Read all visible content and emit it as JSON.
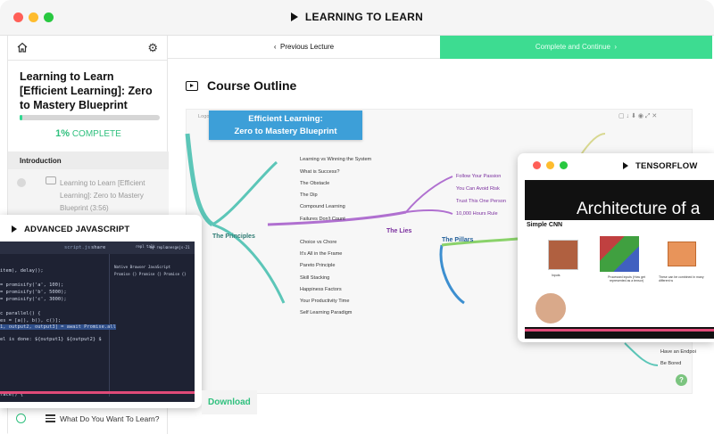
{
  "window": {
    "title": "LEARNING TO LEARN"
  },
  "sidebar": {
    "course_title": "Learning to Learn [Efficient Learning]: Zero to Mastery Blueprint",
    "progress": {
      "percent": 1,
      "percent_text": "1%",
      "label": "COMPLETE"
    },
    "section": "Introduction",
    "lectures": [
      {
        "title": "Learning to Learn [Efficient Learning]: Zero to Mastery Blueprint",
        "duration": "(3:56)"
      }
    ],
    "bottom_item": "What Do You Want To Learn?"
  },
  "nav": {
    "prev": "Previous Lecture",
    "next": "Complete and Continue"
  },
  "main": {
    "heading": "Course Outline",
    "download": "Download",
    "help": "?"
  },
  "mindmap": {
    "root_line1": "Efficient Learning:",
    "root_line2": "Zero to Mastery Blueprint",
    "logo_text": "Logo",
    "branches": {
      "principles": "The Principles",
      "lies": "The Lies",
      "pillars": "The Pillars"
    },
    "principles_items": [
      "Learning vs Winning the System",
      "What is Success?",
      "The Obstacle",
      "The Dip",
      "Compound Learning",
      "Failures Don't Count",
      "Choice vs Chore",
      "It's All in the Frame",
      "Pareto Principle",
      "Skill Stacking",
      "Happiness Factors",
      "Your Productivity Time",
      "Self Learning Paradigm"
    ],
    "lies_items": [
      "Follow Your Passion",
      "You Can Avoid Risk",
      "Trust This One Person",
      "10,000 Hours Rule"
    ],
    "pillars_items": [
      "Have an Endpoi",
      "Be Bored"
    ]
  },
  "js_window": {
    "title": "ADVANCED JAVASCRIPT",
    "tabs": [
      "script.js",
      "share",
      "repl talk",
      "my repls",
      "anesgejs-21"
    ],
    "console_lines": [
      "Native Browser JavaScript",
      "Promise {} Promise {} Promise {}"
    ],
    "code_lines": [
      "item), delay));",
      "= promisify('a', 100);",
      "= promisify('b', 5000);",
      "= promisify('c', 3000);",
      "c parallel() {",
      "es = [a(), b(), c()];",
      "1, output2, output3] = await Promise.all",
      "el is done: ${output1} ${output2} $",
      "race() {"
    ]
  },
  "tf_window": {
    "title": "TENSORFLOW",
    "slide_title": "Architecture of a",
    "slide_subtitle": "Simple CNN",
    "captions": [
      "Inputs",
      "Processed inputs (How get represented as a tensor)",
      "These can be combined in many different w"
    ]
  },
  "colors": {
    "accent": "#3ddc91",
    "mindmap_root": "#3d9fd8",
    "principles": "#5cc6b8",
    "lies": "#9b3fbf",
    "pillars": "#3d8fd0"
  }
}
